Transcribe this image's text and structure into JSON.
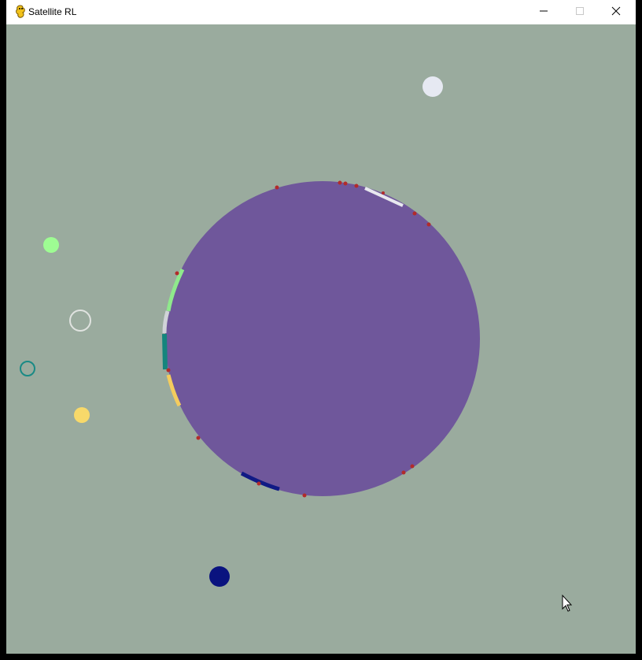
{
  "window": {
    "title": "Satellite RL",
    "icons": {
      "app": "pygame-snake-icon",
      "minimize": "minimize-icon",
      "maximize": "maximize-icon",
      "close": "close-icon"
    }
  },
  "scene": {
    "background_color": "#9aab9e",
    "planet_color": "#6f579b",
    "marker_color": "#b22b2b",
    "satellites": [
      {
        "id": "white",
        "color": "#e6e9f2",
        "style": "filled"
      },
      {
        "id": "light-green",
        "color": "#9efc93",
        "style": "filled"
      },
      {
        "id": "gray-ring",
        "color": "#e0e3e0",
        "style": "ring"
      },
      {
        "id": "teal-ring",
        "color": "#1a8a85",
        "style": "ring"
      },
      {
        "id": "yellow",
        "color": "#f8d96a",
        "style": "filled"
      },
      {
        "id": "navy",
        "color": "#0a137f",
        "style": "filled"
      }
    ],
    "arc_colors": {
      "white": "#e8e8ef",
      "light-green": "#8fe98c",
      "gray": "#d0d3d8",
      "teal": "#14857d",
      "yellow": "#f4cc5e",
      "navy": "#101a85"
    }
  }
}
